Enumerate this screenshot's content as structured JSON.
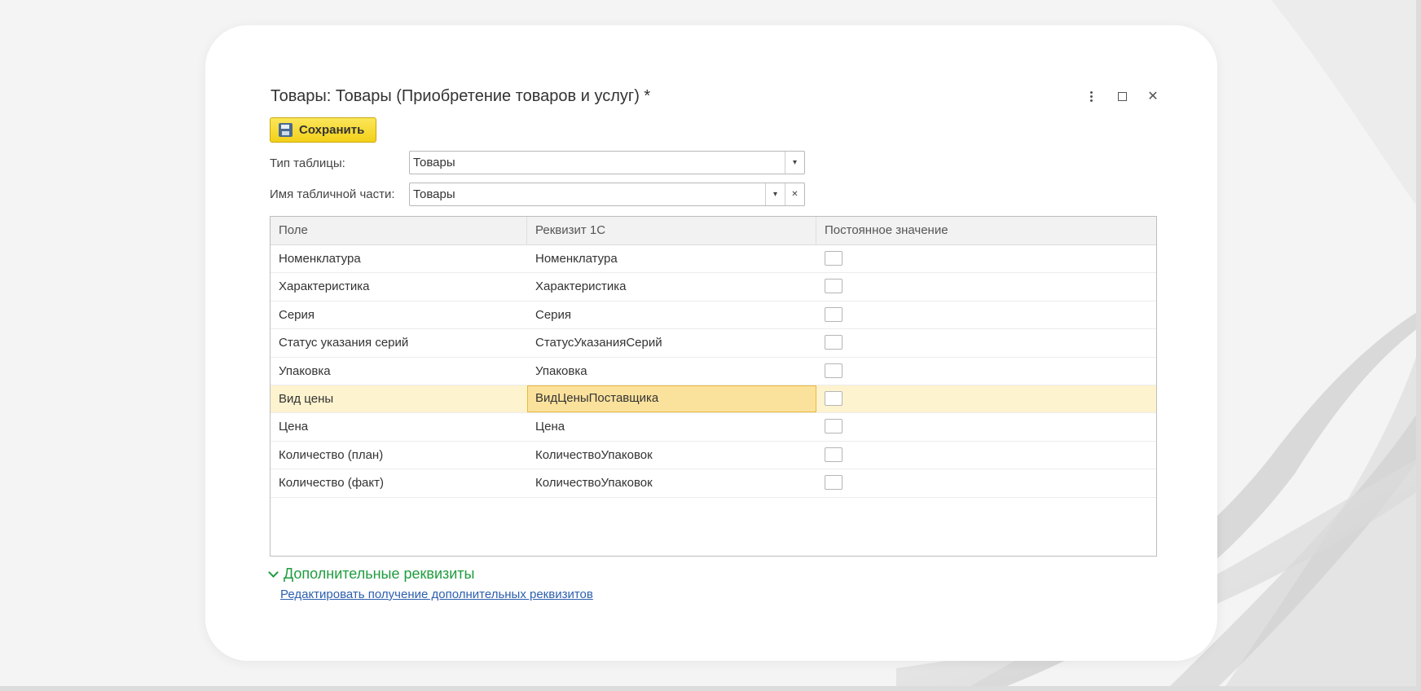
{
  "window": {
    "title": "Товары: Товары (Приобретение товаров и услуг) *",
    "controls": [
      "more-icon",
      "maximize-icon",
      "close-icon"
    ]
  },
  "toolbar": {
    "save_label": "Сохранить",
    "save_icon": "floppy-disk-icon"
  },
  "form": {
    "table_type_label": "Тип таблицы:",
    "table_type_value": "Товары",
    "table_part_label": "Имя табличной части:",
    "table_part_value": "Товары"
  },
  "grid": {
    "columns": [
      "Поле",
      "Реквизит 1С",
      "Постоянное значение"
    ],
    "rows": [
      {
        "field": "Номенклатура",
        "attr": "Номенклатура",
        "constant": false
      },
      {
        "field": "Характеристика",
        "attr": "Характеристика",
        "constant": false
      },
      {
        "field": "Серия",
        "attr": "Серия",
        "constant": false
      },
      {
        "field": "Статус указания серий",
        "attr": "СтатусУказанияСерий",
        "constant": false
      },
      {
        "field": "Упаковка",
        "attr": "Упаковка",
        "constant": false
      },
      {
        "field": "Вид цены",
        "attr": "ВидЦеныПоставщика",
        "constant": false,
        "selected": true
      },
      {
        "field": "Цена",
        "attr": "Цена",
        "constant": false
      },
      {
        "field": "Количество (план)",
        "attr": "КоличествоУпаковок",
        "constant": false
      },
      {
        "field": "Количество (факт)",
        "attr": "КоличествоУпаковок",
        "constant": false
      }
    ]
  },
  "extras": {
    "expander_label": "Дополнительные реквизиты",
    "link_label": "Редактировать получение дополнительных реквизитов"
  },
  "colors": {
    "accent_green": "#1f9c3e",
    "save_yellow": "#f3d019",
    "selected_row": "#fdf3cf",
    "link_blue": "#2d5fae"
  }
}
